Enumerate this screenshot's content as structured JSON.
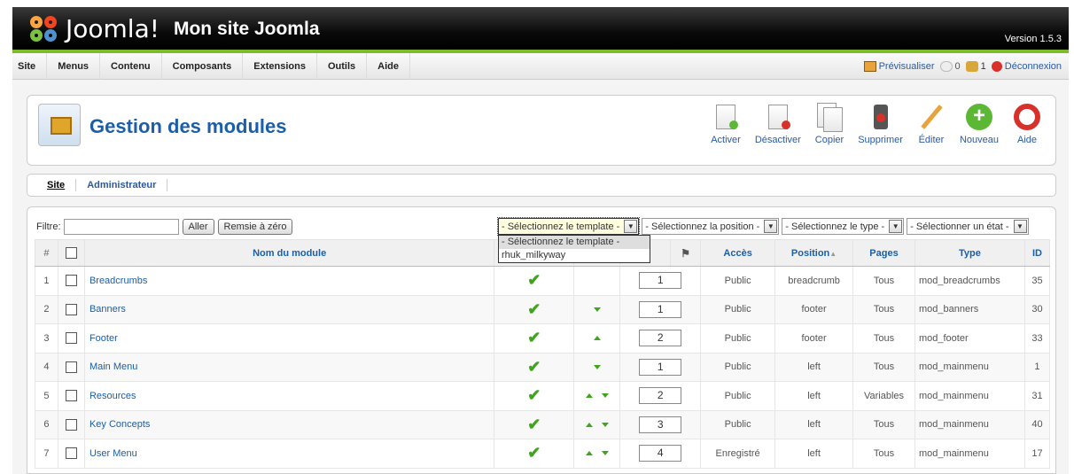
{
  "header": {
    "logo_text": "Joomla!",
    "site_name": "Mon site Joomla",
    "version": "Version 1.5.3"
  },
  "menu": [
    "Site",
    "Menus",
    "Contenu",
    "Composants",
    "Extensions",
    "Outils",
    "Aide"
  ],
  "status": {
    "preview": "Prévisualiser",
    "messages": "0",
    "users": "1",
    "logout": "Déconnexion"
  },
  "page_title": "Gestion des modules",
  "toolbar": [
    {
      "label": "Activer",
      "icon": "activate-icon"
    },
    {
      "label": "Désactiver",
      "icon": "deactivate-icon"
    },
    {
      "label": "Copier",
      "icon": "copy-icon"
    },
    {
      "label": "Supprimer",
      "icon": "delete-icon"
    },
    {
      "label": "Éditer",
      "icon": "edit-icon"
    },
    {
      "label": "Nouveau",
      "icon": "new-icon"
    },
    {
      "label": "Aide",
      "icon": "help-icon"
    }
  ],
  "tabs": [
    "Site",
    "Administrateur"
  ],
  "filter": {
    "label": "Filtre:",
    "value": "",
    "go": "Aller",
    "reset": "Remsie à zéro",
    "template": "- Sélectionnez le template -",
    "position": "- Sélectionnez la position -",
    "type": "- Sélectionnez le type -",
    "state": "- Sélectionner un état -",
    "template_options": [
      "- Sélectionnez le template -",
      "rhuk_milkyway"
    ]
  },
  "columns": {
    "num": "#",
    "name": "Nom du module",
    "access": "Accès",
    "position": "Position",
    "pages": "Pages",
    "type": "Type",
    "id": "ID"
  },
  "rows": [
    {
      "num": "1",
      "name": "Breadcrumbs",
      "order": "1",
      "up": false,
      "down": false,
      "access": "Public",
      "position": "breadcrumb",
      "pages": "Tous",
      "type": "mod_breadcrumbs",
      "id": "35"
    },
    {
      "num": "2",
      "name": "Banners",
      "order": "1",
      "up": false,
      "down": true,
      "access": "Public",
      "position": "footer",
      "pages": "Tous",
      "type": "mod_banners",
      "id": "30"
    },
    {
      "num": "3",
      "name": "Footer",
      "order": "2",
      "up": true,
      "down": false,
      "access": "Public",
      "position": "footer",
      "pages": "Tous",
      "type": "mod_footer",
      "id": "33"
    },
    {
      "num": "4",
      "name": "Main Menu",
      "order": "1",
      "up": false,
      "down": true,
      "access": "Public",
      "position": "left",
      "pages": "Tous",
      "type": "mod_mainmenu",
      "id": "1"
    },
    {
      "num": "5",
      "name": "Resources",
      "order": "2",
      "up": true,
      "down": true,
      "access": "Public",
      "position": "left",
      "pages": "Variables",
      "type": "mod_mainmenu",
      "id": "31"
    },
    {
      "num": "6",
      "name": "Key Concepts",
      "order": "3",
      "up": true,
      "down": true,
      "access": "Public",
      "position": "left",
      "pages": "Tous",
      "type": "mod_mainmenu",
      "id": "40"
    },
    {
      "num": "7",
      "name": "User Menu",
      "order": "4",
      "up": true,
      "down": true,
      "access": "Enregistré",
      "position": "left",
      "pages": "Tous",
      "type": "mod_mainmenu",
      "id": "17"
    }
  ]
}
